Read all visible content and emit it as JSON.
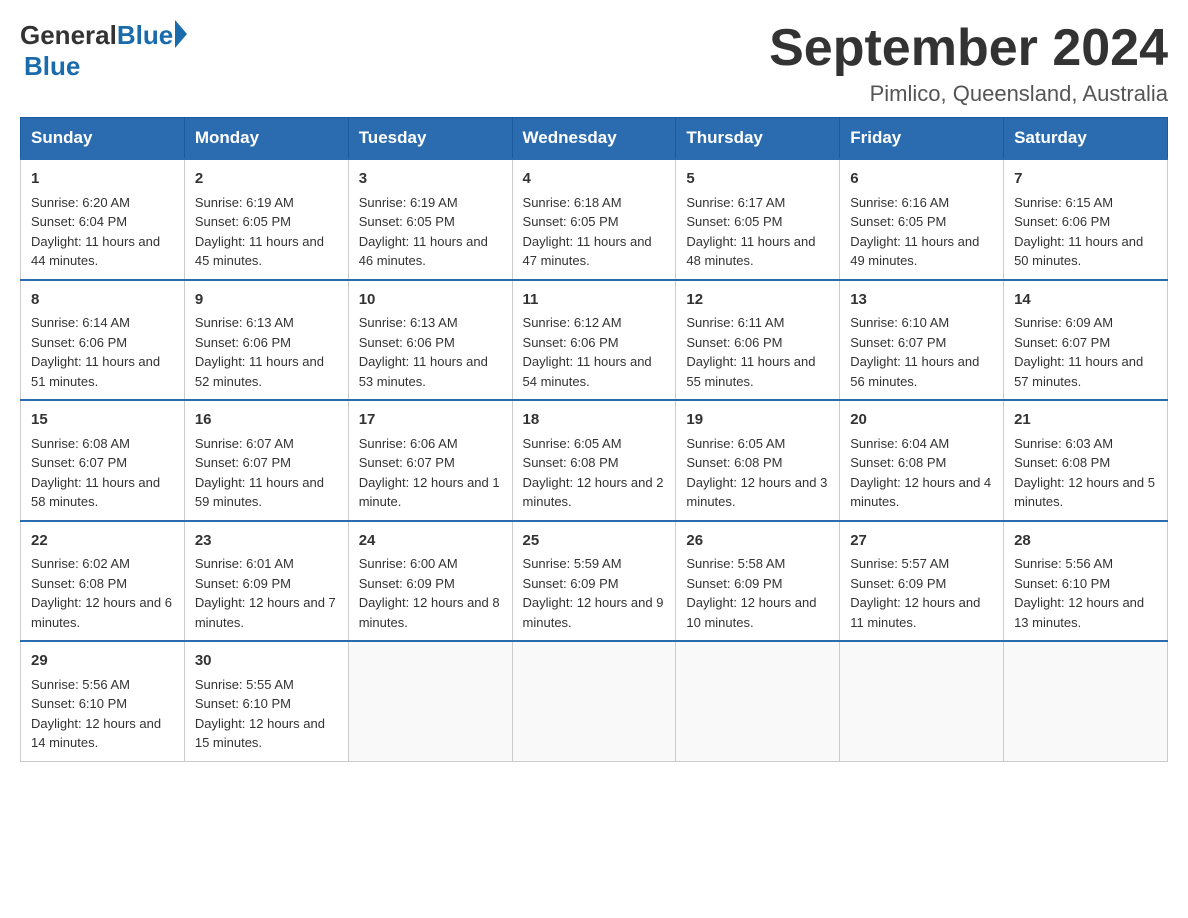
{
  "logo": {
    "general": "General",
    "blue": "Blue",
    "triangle_color": "#1a6bac"
  },
  "title": "September 2024",
  "subtitle": "Pimlico, Queensland, Australia",
  "headers": [
    "Sunday",
    "Monday",
    "Tuesday",
    "Wednesday",
    "Thursday",
    "Friday",
    "Saturday"
  ],
  "weeks": [
    [
      {
        "day": "1",
        "sunrise": "6:20 AM",
        "sunset": "6:04 PM",
        "daylight": "11 hours and 44 minutes."
      },
      {
        "day": "2",
        "sunrise": "6:19 AM",
        "sunset": "6:05 PM",
        "daylight": "11 hours and 45 minutes."
      },
      {
        "day": "3",
        "sunrise": "6:19 AM",
        "sunset": "6:05 PM",
        "daylight": "11 hours and 46 minutes."
      },
      {
        "day": "4",
        "sunrise": "6:18 AM",
        "sunset": "6:05 PM",
        "daylight": "11 hours and 47 minutes."
      },
      {
        "day": "5",
        "sunrise": "6:17 AM",
        "sunset": "6:05 PM",
        "daylight": "11 hours and 48 minutes."
      },
      {
        "day": "6",
        "sunrise": "6:16 AM",
        "sunset": "6:05 PM",
        "daylight": "11 hours and 49 minutes."
      },
      {
        "day": "7",
        "sunrise": "6:15 AM",
        "sunset": "6:06 PM",
        "daylight": "11 hours and 50 minutes."
      }
    ],
    [
      {
        "day": "8",
        "sunrise": "6:14 AM",
        "sunset": "6:06 PM",
        "daylight": "11 hours and 51 minutes."
      },
      {
        "day": "9",
        "sunrise": "6:13 AM",
        "sunset": "6:06 PM",
        "daylight": "11 hours and 52 minutes."
      },
      {
        "day": "10",
        "sunrise": "6:13 AM",
        "sunset": "6:06 PM",
        "daylight": "11 hours and 53 minutes."
      },
      {
        "day": "11",
        "sunrise": "6:12 AM",
        "sunset": "6:06 PM",
        "daylight": "11 hours and 54 minutes."
      },
      {
        "day": "12",
        "sunrise": "6:11 AM",
        "sunset": "6:06 PM",
        "daylight": "11 hours and 55 minutes."
      },
      {
        "day": "13",
        "sunrise": "6:10 AM",
        "sunset": "6:07 PM",
        "daylight": "11 hours and 56 minutes."
      },
      {
        "day": "14",
        "sunrise": "6:09 AM",
        "sunset": "6:07 PM",
        "daylight": "11 hours and 57 minutes."
      }
    ],
    [
      {
        "day": "15",
        "sunrise": "6:08 AM",
        "sunset": "6:07 PM",
        "daylight": "11 hours and 58 minutes."
      },
      {
        "day": "16",
        "sunrise": "6:07 AM",
        "sunset": "6:07 PM",
        "daylight": "11 hours and 59 minutes."
      },
      {
        "day": "17",
        "sunrise": "6:06 AM",
        "sunset": "6:07 PM",
        "daylight": "12 hours and 1 minute."
      },
      {
        "day": "18",
        "sunrise": "6:05 AM",
        "sunset": "6:08 PM",
        "daylight": "12 hours and 2 minutes."
      },
      {
        "day": "19",
        "sunrise": "6:05 AM",
        "sunset": "6:08 PM",
        "daylight": "12 hours and 3 minutes."
      },
      {
        "day": "20",
        "sunrise": "6:04 AM",
        "sunset": "6:08 PM",
        "daylight": "12 hours and 4 minutes."
      },
      {
        "day": "21",
        "sunrise": "6:03 AM",
        "sunset": "6:08 PM",
        "daylight": "12 hours and 5 minutes."
      }
    ],
    [
      {
        "day": "22",
        "sunrise": "6:02 AM",
        "sunset": "6:08 PM",
        "daylight": "12 hours and 6 minutes."
      },
      {
        "day": "23",
        "sunrise": "6:01 AM",
        "sunset": "6:09 PM",
        "daylight": "12 hours and 7 minutes."
      },
      {
        "day": "24",
        "sunrise": "6:00 AM",
        "sunset": "6:09 PM",
        "daylight": "12 hours and 8 minutes."
      },
      {
        "day": "25",
        "sunrise": "5:59 AM",
        "sunset": "6:09 PM",
        "daylight": "12 hours and 9 minutes."
      },
      {
        "day": "26",
        "sunrise": "5:58 AM",
        "sunset": "6:09 PM",
        "daylight": "12 hours and 10 minutes."
      },
      {
        "day": "27",
        "sunrise": "5:57 AM",
        "sunset": "6:09 PM",
        "daylight": "12 hours and 11 minutes."
      },
      {
        "day": "28",
        "sunrise": "5:56 AM",
        "sunset": "6:10 PM",
        "daylight": "12 hours and 13 minutes."
      }
    ],
    [
      {
        "day": "29",
        "sunrise": "5:56 AM",
        "sunset": "6:10 PM",
        "daylight": "12 hours and 14 minutes."
      },
      {
        "day": "30",
        "sunrise": "5:55 AM",
        "sunset": "6:10 PM",
        "daylight": "12 hours and 15 minutes."
      },
      null,
      null,
      null,
      null,
      null
    ]
  ],
  "labels": {
    "sunrise": "Sunrise:",
    "sunset": "Sunset:",
    "daylight": "Daylight:"
  }
}
